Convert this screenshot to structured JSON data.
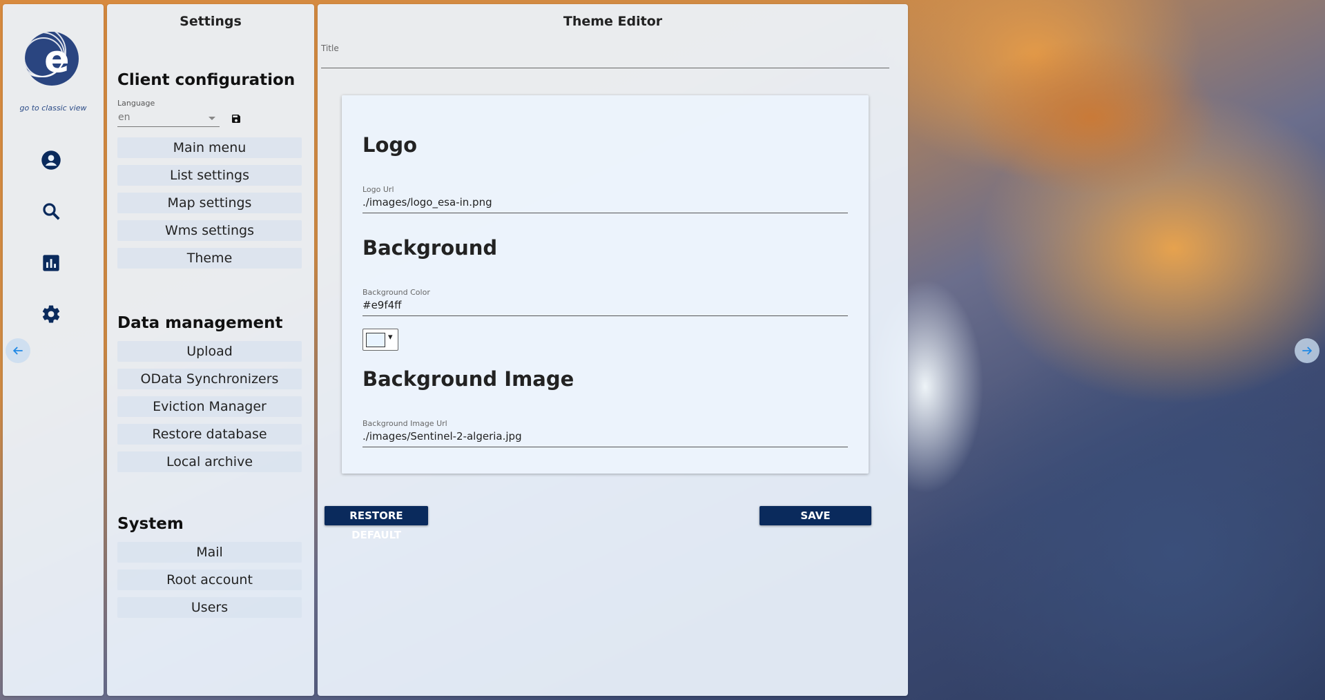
{
  "left_rail": {
    "classic_link": "go to classic view",
    "icons": [
      "account-circle-icon",
      "search-icon",
      "chart-icon",
      "gear-icon"
    ],
    "colors": {
      "icon": "#0a2a5c",
      "arrow": "#1e88e5"
    }
  },
  "settings": {
    "title": "Settings",
    "client_config": {
      "heading": "Client configuration",
      "language_label": "Language",
      "language_value": "en",
      "items": [
        "Main menu",
        "List settings",
        "Map settings",
        "Wms settings",
        "Theme"
      ]
    },
    "data_management": {
      "heading": "Data management",
      "items": [
        "Upload",
        "OData Synchronizers",
        "Eviction Manager",
        "Restore database",
        "Local archive"
      ]
    },
    "system": {
      "heading": "System",
      "items": [
        "Mail",
        "Root account",
        "Users"
      ]
    }
  },
  "editor": {
    "title": "Theme Editor",
    "title_field_label": "Title",
    "title_field_value": "",
    "logo": {
      "heading": "Logo",
      "url_label": "Logo Url",
      "url_value": "./images/logo_esa-in.png"
    },
    "background": {
      "heading": "Background",
      "color_label": "Background Color",
      "color_value": "#e9f4ff"
    },
    "background_image": {
      "heading": "Background Image",
      "url_label": "Background Image Url",
      "url_value": "./images/Sentinel-2-algeria.jpg"
    },
    "restore_button": "RESTORE DEFAULT",
    "save_button": "SAVE"
  }
}
